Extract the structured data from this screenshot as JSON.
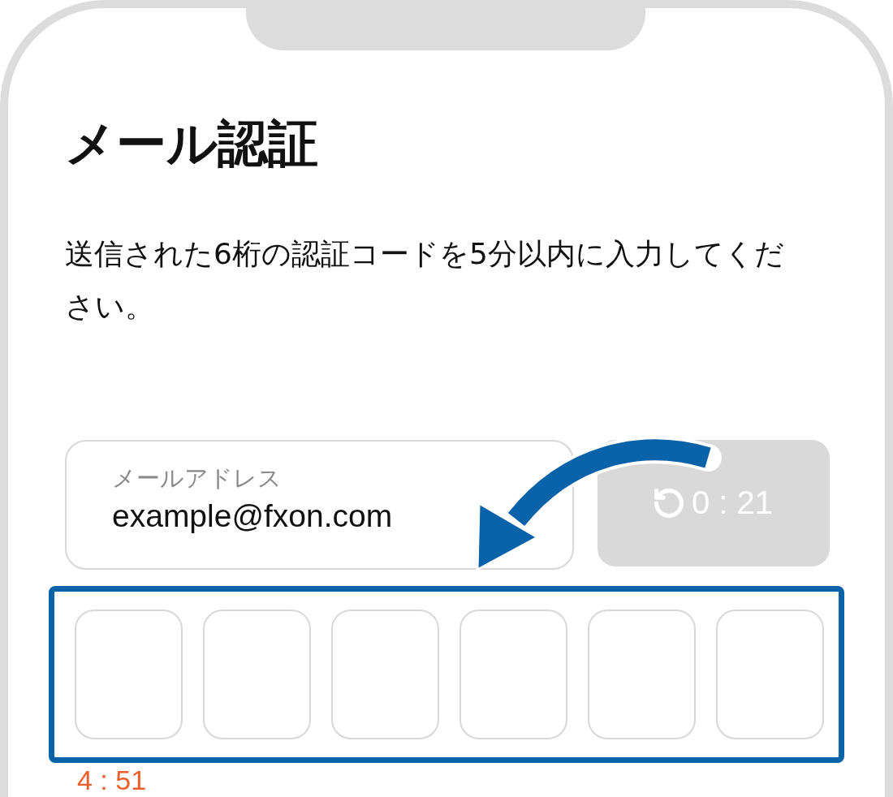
{
  "title": "メール認証",
  "description": "送信された6桁の認証コードを5分以内に入力してください。",
  "email_field": {
    "label": "メールアドレス",
    "value": "example@fxon.com"
  },
  "resend_button": {
    "countdown": "0 : 21",
    "disabled": true
  },
  "code_input": {
    "highlighted": true,
    "boxes": [
      {
        "kind": "digit"
      },
      {
        "kind": "digit"
      },
      {
        "kind": "digit"
      },
      {
        "kind": "digit"
      },
      {
        "kind": "digit"
      },
      {
        "kind": "digit"
      }
    ]
  },
  "timer": "4 : 51"
}
